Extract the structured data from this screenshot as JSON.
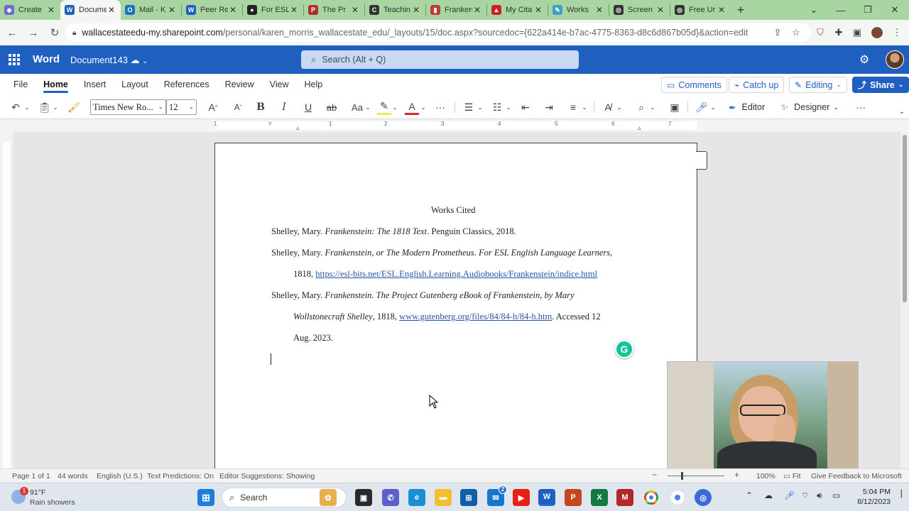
{
  "browser": {
    "tabs": [
      {
        "label": "Create",
        "icon": "create-icon",
        "color": "#6b6bd6"
      },
      {
        "label": "Document",
        "icon": "word-icon",
        "color": "#1f5fbf",
        "active": true
      },
      {
        "label": "Mail - K",
        "icon": "outlook-icon",
        "color": "#1b73c8"
      },
      {
        "label": "Peer Re",
        "icon": "word-icon",
        "color": "#1f5fbf"
      },
      {
        "label": "For ESL",
        "icon": "paw-icon",
        "color": "#222222"
      },
      {
        "label": "The Pr",
        "icon": "pg-icon",
        "color": "#b03030"
      },
      {
        "label": "Teachin",
        "icon": "teaching-icon",
        "color": "#333333"
      },
      {
        "label": "Franken",
        "icon": "book-icon",
        "color": "#c23b3b"
      },
      {
        "label": "My Cita",
        "icon": "citation-icon",
        "color": "#cc2222"
      },
      {
        "label": "Works",
        "icon": "works-icon",
        "color": "#3aa1c9"
      },
      {
        "label": "Screen",
        "icon": "screen-icon",
        "color": "#333333"
      },
      {
        "label": "Free Ur",
        "icon": "free-icon",
        "color": "#333333"
      }
    ],
    "new_tab": "+",
    "url_host": "wallacestateedu-my.sharepoint.com",
    "url_path": "/personal/karen_morris_wallacestate_edu/_layouts/15/doc.aspx?sourcedoc={622a414e-b7ac-4775-8363-d8c6d867b05d}&action=edit"
  },
  "word": {
    "app": "Word",
    "doc_name": "Document143",
    "search_placeholder": "Search (Alt + Q)",
    "ribbon_tabs": [
      "File",
      "Home",
      "Insert",
      "Layout",
      "References",
      "Review",
      "View",
      "Help"
    ],
    "active_tab": "Home",
    "comments": "Comments",
    "catch_up": "Catch up",
    "editing": "Editing",
    "share": "Share",
    "font_name": "Times New Ro...",
    "font_size": "12",
    "editor_label": "Editor",
    "designer_label": "Designer",
    "ruler_numbers": [
      "1",
      "1",
      "2",
      "3",
      "4",
      "5",
      "6",
      "7"
    ]
  },
  "document": {
    "heading": "Works Cited",
    "entries": [
      {
        "line1_a": "Shelley, Mary. ",
        "line1_i": "Frankenstein: The 1818 Text",
        "line1_b": ". Penguin Classics, 2018."
      },
      {
        "line1_a": "Shelley, Mary. ",
        "line1_i": "Frankenstein, or The Modern Prometheus. For ESL English Language Learners",
        "line1_b": ",",
        "line2_a": "1818,  ",
        "line2_link": "https://esl-bits.net/ESL.English.Learning.Audiobooks/Frankenstein/indice.html"
      },
      {
        "line1_a": "Shelley, Mary. ",
        "line1_i": "Frankenstein. The Project Gutenberg eBook of Frankenstein, by Mary",
        "line2_i": "Wollstonecraft Shelley",
        "line2_a": ", 1818,  ",
        "line2_link": "www.gutenberg.org/files/84/84-h/84-h.htm",
        "line2_b": ". Accessed 12",
        "line3": "Aug. 2023."
      }
    ]
  },
  "status": {
    "page": "Page 1 of 1",
    "words": "44 words",
    "language": "English (U.S.)",
    "predictions": "Text Predictions: On",
    "suggestions": "Editor Suggestions: Showing",
    "zoom": "100%",
    "fit": "Fit",
    "feedback": "Give Feedback to Microsoft"
  },
  "taskbar": {
    "weather_temp": "91°F",
    "weather_desc": "Rain showers",
    "weather_badge": "1",
    "search_label": "Search",
    "time": "5:04 PM",
    "date": "8/12/2023",
    "mail_badge": "2"
  },
  "colors": {
    "word_blue": "#1f5fbf",
    "tab_strip": "#a8d5a2",
    "link": "#2a55a6",
    "grammarly": "#15c39a"
  }
}
